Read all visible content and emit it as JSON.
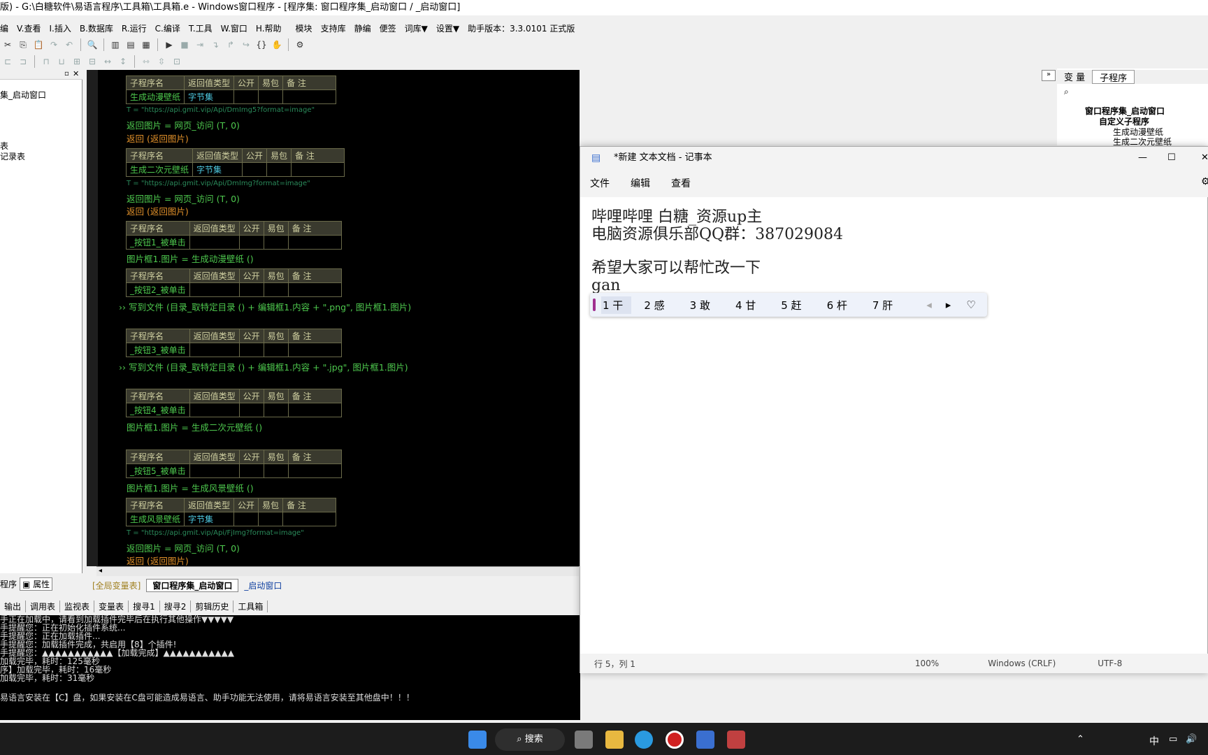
{
  "window_title": "版) - G:\\白糖软件\\易语言程序\\工具箱\\工具箱.e - Windows窗口程序 - [程序集: 窗口程序集_启动窗口 / _启动窗口]",
  "menu": [
    "编",
    "V.查看",
    "I.插入",
    "B.数据库",
    "R.运行",
    "C.编译",
    "T.工具",
    "W.窗口",
    "H.帮助",
    "模块",
    "支持库",
    "静编",
    "便签",
    "词库▼",
    "设置▼",
    "助手版本：3.3.0101 正式版"
  ],
  "left_panel": {
    "items": [
      "集_启动窗口",
      "表",
      "记录表"
    ],
    "bottom_tabs": [
      "程序",
      "属性"
    ]
  },
  "editor": {
    "tables": [
      {
        "headers": [
          "子程序名",
          "返回值类型",
          "公开",
          "易包",
          "备 注"
        ],
        "name": "生成动漫壁纸",
        "type": "字节集"
      },
      {
        "headers": [
          "子程序名",
          "返回值类型",
          "公开",
          "易包",
          "备 注"
        ],
        "name": "生成二次元壁纸",
        "type": "字节集"
      },
      {
        "headers": [
          "子程序名",
          "返回值类型",
          "公开",
          "易包",
          "备 注"
        ],
        "name": "_按钮1_被单击",
        "type": ""
      },
      {
        "headers": [
          "子程序名",
          "返回值类型",
          "公开",
          "易包",
          "备 注"
        ],
        "name": "_按钮2_被单击",
        "type": ""
      },
      {
        "headers": [
          "子程序名",
          "返回值类型",
          "公开",
          "易包",
          "备 注"
        ],
        "name": "_按钮3_被单击",
        "type": ""
      },
      {
        "headers": [
          "子程序名",
          "返回值类型",
          "公开",
          "易包",
          "备 注"
        ],
        "name": "_按钮4_被单击",
        "type": ""
      },
      {
        "headers": [
          "子程序名",
          "返回值类型",
          "公开",
          "易包",
          "备 注"
        ],
        "name": "_按钮5_被单击",
        "type": ""
      },
      {
        "headers": [
          "子程序名",
          "返回值类型",
          "公开",
          "易包",
          "备 注"
        ],
        "name": "生成风景壁纸",
        "type": "字节集"
      }
    ],
    "code": {
      "t1": "T = \"https://api.gmit.vip/Api/DmImg5?format=image\"",
      "r1": "返回图片 = 网页_访问 (T, 0)",
      "ret1": "返回 (返回图片)",
      "t2": "T = \"https://api.gmit.vip/Api/DmImg?format=image\"",
      "r2": "返回图片 = 网页_访问 (T, 0)",
      "ret2": "返回 (返回图片)",
      "b1": "图片框1.图片 = 生成动漫壁纸 ()",
      "b2": "写到文件 (目录_取特定目录 () + 编辑框1.内容 + \".png\", 图片框1.图片)",
      "b3": "写到文件 (目录_取特定目录 () + 编辑框1.内容 + \".jpg\", 图片框1.图片)",
      "b4": "图片框1.图片 = 生成二次元壁纸 ()",
      "b5": "图片框1.图片 = 生成风景壁纸 ()",
      "t3": "T = \"https://api.gmit.vip/Api/FjImg?format=image\"",
      "r3": "返回图片 = 网页_访问 (T, 0)",
      "ret3": "返回 (返回图片)"
    },
    "tabs": [
      "[全局变量表]",
      "窗口程序集_启动窗口",
      "_启动窗口"
    ]
  },
  "bottom_tabs": [
    "输出",
    "调用表",
    "监视表",
    "变量表",
    "搜寻1",
    "搜寻2",
    "剪辑历史",
    "工具箱"
  ],
  "output_lines": [
    "手正在加载中，请看到加载插件完毕后在执行其他操作▼▼▼▼▼",
    "手提醒您：正在初始化插件系统...",
    "手提醒您：正在加载插件...",
    "手提醒您：加载插件完成，共启用【8】个插件!",
    "手提醒您：▲▲▲▲▲▲▲▲▲▲▲【加载完成】▲▲▲▲▲▲▲▲▲▲▲",
    "加载完毕，耗时：125毫秒",
    "序】加载完毕，耗时：16毫秒",
    "加载完毕，耗时：31毫秒",
    "",
    "易语言安装在【C】盘，如果安装在C盘可能造成易语言、助手功能无法使用，请将易语言安装至其他盘中！！！"
  ],
  "right_panel": {
    "tabs": [
      "变 量",
      "子程序"
    ],
    "tree": [
      "窗口程序集_启动窗口",
      "自定义子程序",
      "生成动漫壁纸",
      "生成二次元壁纸"
    ]
  },
  "notepad": {
    "title": "*新建 文本文档 - 记事本",
    "menu": [
      "文件",
      "编辑",
      "查看"
    ],
    "lines": [
      "哔哩哔哩 白糖_资源up主",
      "电脑资源俱乐部QQ群：387029084",
      "",
      "希望大家可以帮忙改一下",
      "gan"
    ],
    "ime_candidates": [
      "1 干",
      "2 感",
      "3 敢",
      "4 甘",
      "5 赶",
      "6 杆",
      "7 肝"
    ],
    "status": {
      "position": "行 5，列 1",
      "zoom": "100%",
      "eol": "Windows (CRLF)",
      "encoding": "UTF-8"
    }
  },
  "taskbar": {
    "search": "搜索",
    "ime": "中"
  }
}
